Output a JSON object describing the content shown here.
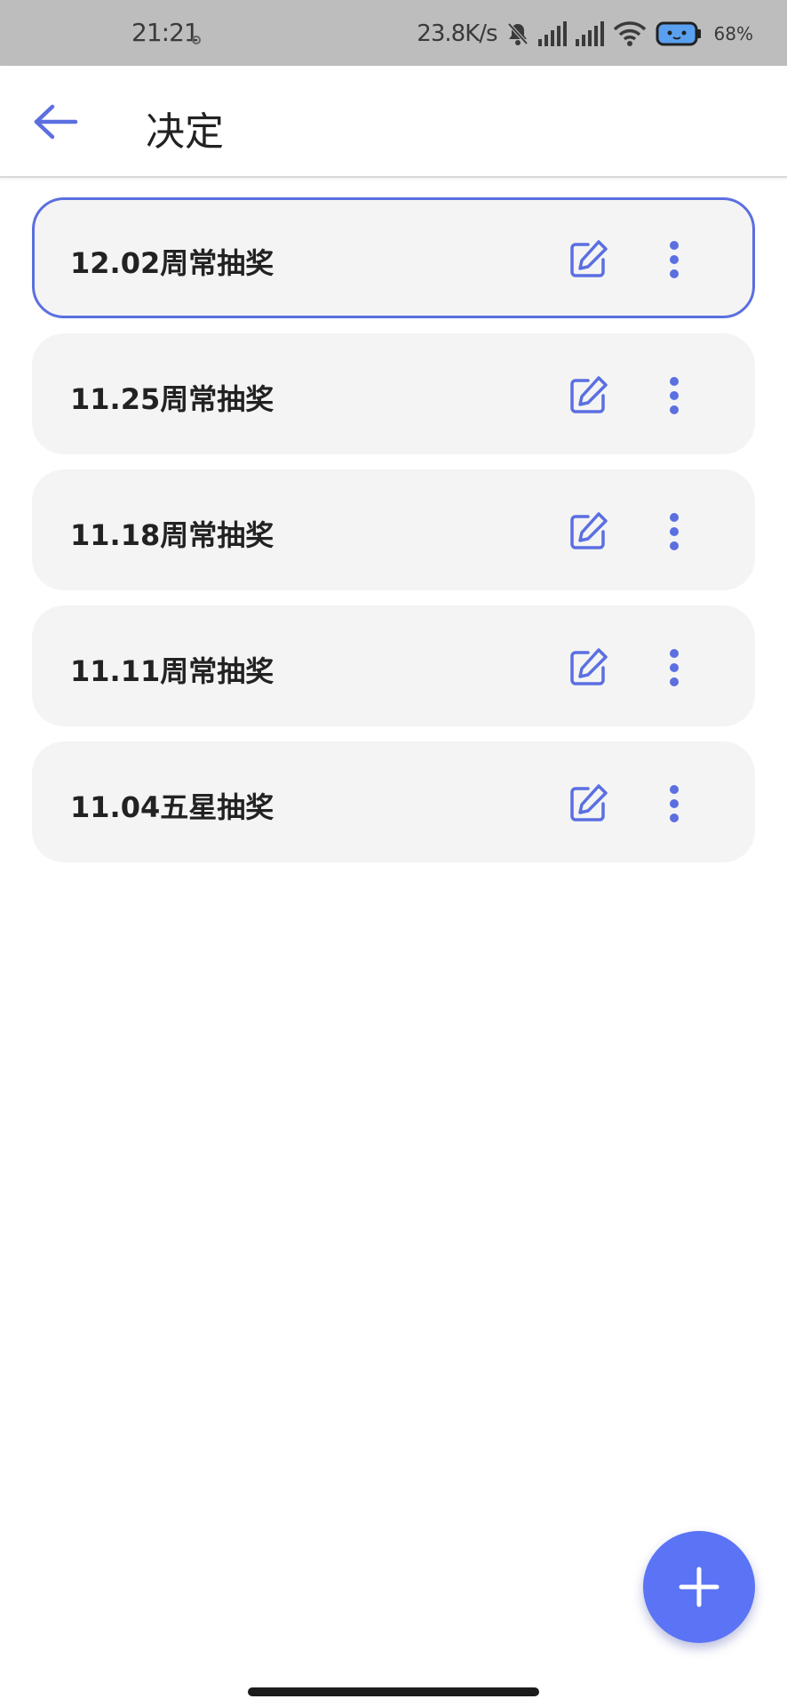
{
  "status_bar": {
    "time": "21:21",
    "net_speed": "23.8K/s",
    "battery": "68%"
  },
  "header": {
    "title": "决定"
  },
  "items": [
    {
      "title": "12.02周常抽奖",
      "selected": true
    },
    {
      "title": "11.25周常抽奖",
      "selected": false
    },
    {
      "title": "11.18周常抽奖",
      "selected": false
    },
    {
      "title": "11.11周常抽奖",
      "selected": false
    },
    {
      "title": "11.04五星抽奖",
      "selected": false
    }
  ],
  "icons": {
    "back": "arrow-left-icon",
    "edit": "edit-icon",
    "more": "more-vertical-icon",
    "add": "plus-icon"
  },
  "colors": {
    "accent": "#5b6fe0",
    "fab": "#5b73f5",
    "card_bg": "#f4f4f4",
    "status_bar_bg": "#bdbdbd"
  }
}
